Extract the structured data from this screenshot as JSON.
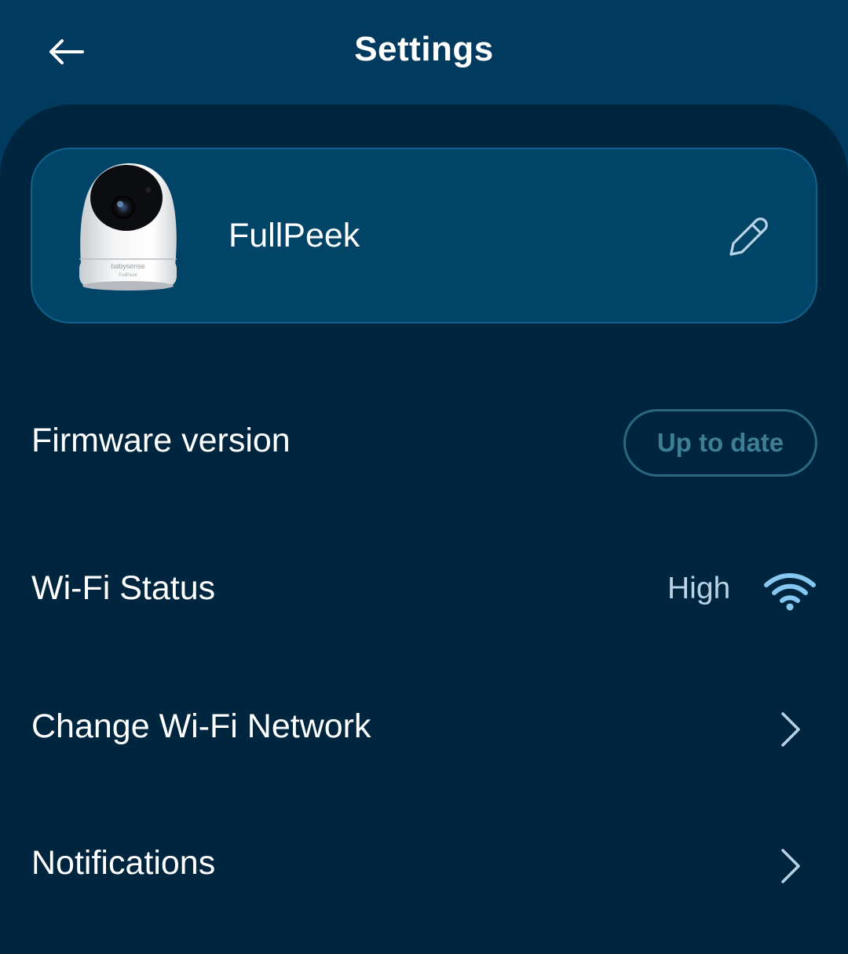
{
  "header": {
    "title": "Settings",
    "back_icon": "arrow-left-icon"
  },
  "device": {
    "name": "FullPeek",
    "camera_brand": "babysense",
    "camera_model": "FullPeek",
    "edit_icon": "pencil-icon"
  },
  "settings": {
    "firmware": {
      "label": "Firmware version",
      "status": "Up to date"
    },
    "wifi_status": {
      "label": "Wi-Fi Status",
      "value": "High",
      "icon": "wifi-icon"
    },
    "change_wifi": {
      "label": "Change Wi-Fi Network",
      "icon": "chevron-right-icon"
    },
    "notifications": {
      "label": "Notifications",
      "icon": "chevron-right-icon"
    }
  },
  "colors": {
    "header_bg": "#003a5e",
    "panel_bg": "#00263f",
    "card_bg": "#004468",
    "accent_light": "#b9d3e6",
    "pill_border": "#2c6880"
  }
}
